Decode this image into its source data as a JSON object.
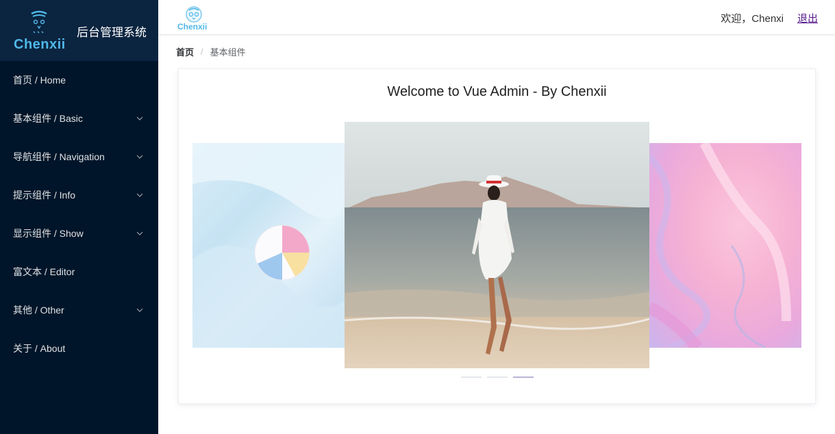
{
  "brand": {
    "logo_word": "Chenxii",
    "system_title": "后台管理系统"
  },
  "sidebar": {
    "items": [
      {
        "label": "首页 / Home",
        "has_submenu": false
      },
      {
        "label": "基本组件 / Basic",
        "has_submenu": true
      },
      {
        "label": "导航组件 / Navigation",
        "has_submenu": true
      },
      {
        "label": "提示组件 / Info",
        "has_submenu": true
      },
      {
        "label": "显示组件 / Show",
        "has_submenu": true
      },
      {
        "label": "富文本 / Editor",
        "has_submenu": false
      },
      {
        "label": "其他 / Other",
        "has_submenu": true
      },
      {
        "label": "关于 / About",
        "has_submenu": false
      }
    ]
  },
  "header": {
    "logo_word": "Chenxii",
    "welcome": "欢迎，Chenxi",
    "logout": "退出"
  },
  "breadcrumb": {
    "home": "首页",
    "separator": "/",
    "current": "基本组件"
  },
  "main": {
    "title": "Welcome to Vue Admin - By Chenxii",
    "carousel": {
      "slide_count": 3,
      "active_index": 2
    }
  },
  "colors": {
    "sidebar_bg": "#001529",
    "sidebar_head_bg": "#0b2440",
    "brand_blue": "#4fb8e8",
    "logout_link": "#551a8b"
  }
}
